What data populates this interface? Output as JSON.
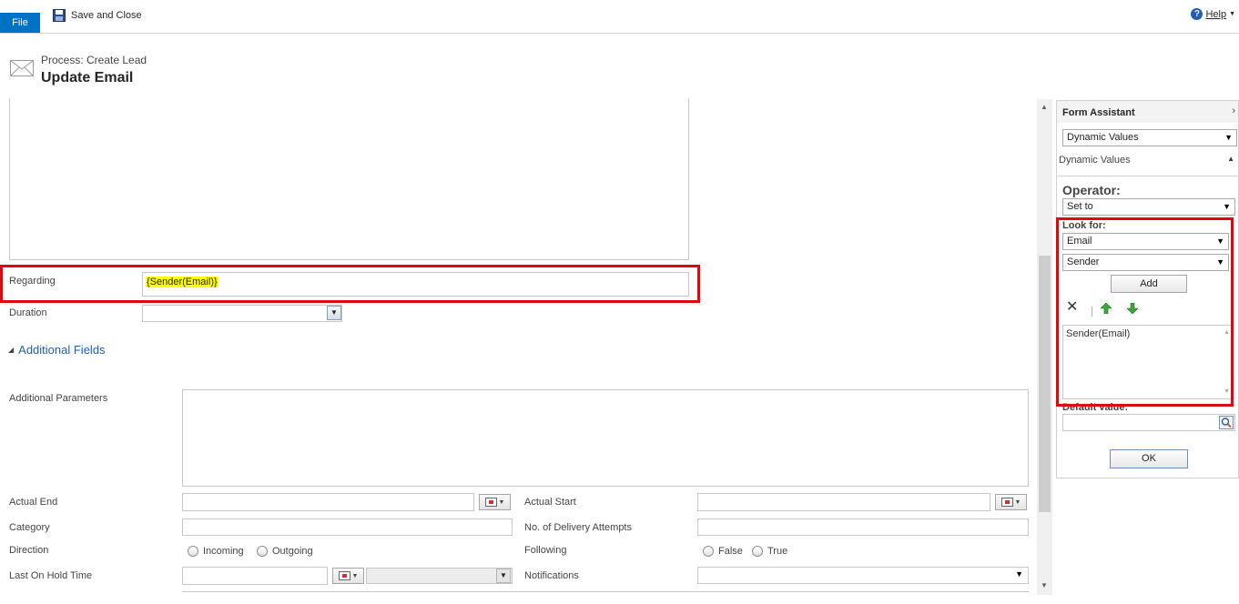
{
  "ribbon": {
    "file_label": "File",
    "save_close_label": "Save and Close",
    "help_label": "Help"
  },
  "header": {
    "process": "Process: Create Lead",
    "title": "Update Email"
  },
  "form": {
    "regarding_label": "Regarding",
    "regarding_value": "{Sender(Email)}",
    "duration_label": "Duration",
    "section_title": "Additional Fields",
    "additional_params_label": "Additional Parameters",
    "actual_end_label": "Actual End",
    "actual_start_label": "Actual Start",
    "category_label": "Category",
    "delivery_attempts_label": "No. of Delivery Attempts",
    "direction_label": "Direction",
    "direction_options": [
      "Incoming",
      "Outgoing"
    ],
    "following_label": "Following",
    "following_options": [
      "False",
      "True"
    ],
    "last_on_hold_label": "Last On Hold Time",
    "notifications_label": "Notifications"
  },
  "form_assistant": {
    "title": "Form Assistant",
    "view_select": "Dynamic Values",
    "section_label": "Dynamic Values",
    "operator_label": "Operator:",
    "operator_value": "Set to",
    "look_for_label": "Look for:",
    "look_for_entity": "Email",
    "look_for_field": "Sender",
    "add_label": "Add",
    "selected_value": "Sender(Email)",
    "default_value_label": "Default value:",
    "ok_label": "OK"
  },
  "colors": {
    "accent": "#0072c6",
    "highlight": "#e0080e",
    "token_bg": "#ffff00",
    "link": "#1f5fae"
  }
}
